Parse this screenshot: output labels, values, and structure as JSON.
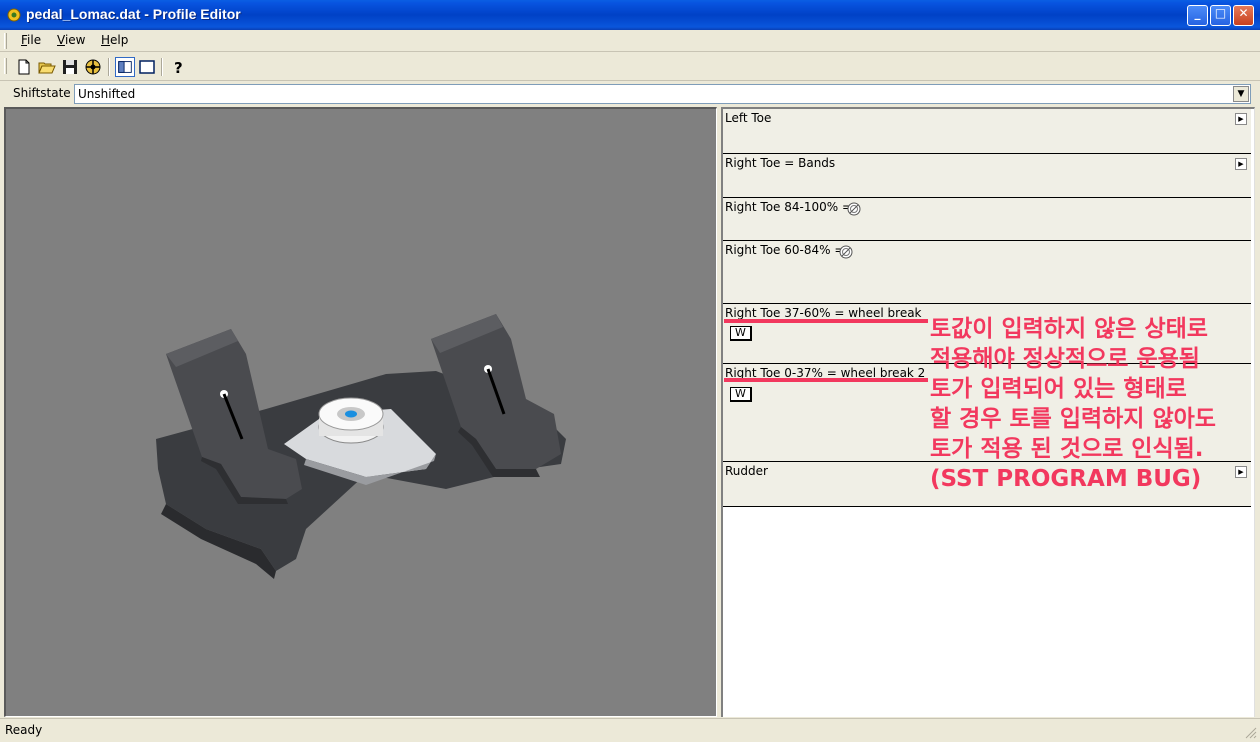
{
  "window": {
    "title": "pedal_Lomac.dat - Profile Editor",
    "minimize_glyph": "_",
    "maximize_glyph": "□",
    "close_glyph": "✕"
  },
  "menu": {
    "file": {
      "key": "F",
      "rest": "ile"
    },
    "view": {
      "key": "V",
      "rest": "iew"
    },
    "help": {
      "key": "H",
      "rest": "elp"
    }
  },
  "toolbar": {
    "icons": [
      "new-document-icon",
      "open-folder-icon",
      "save-disk-icon",
      "target-icon",
      "split-view-icon",
      "single-view-icon",
      "help-icon"
    ]
  },
  "shiftstate": {
    "label": "Shiftstate",
    "value": "Unshifted"
  },
  "panel": {
    "items": [
      {
        "label": "Left Toe",
        "arrow": "▶"
      },
      {
        "label": "Right Toe = Bands",
        "arrow": "▶"
      },
      {
        "label": "Right Toe 84-100% ="
      },
      {
        "label": "Right Toe 60-84% ="
      },
      {
        "label": "Right Toe 37-60% = wheel break",
        "button": "W"
      },
      {
        "label": "Right Toe 0-37% = wheel break 2",
        "button": "W"
      },
      {
        "label": "Rudder",
        "arrow": "▶"
      }
    ]
  },
  "annotation": {
    "lines": [
      "토값이 입력하지 않은 상태로",
      "적용해야 정상적으로 운용됨",
      "토가 입력되어 있는 형태로",
      "할 경우 토를 입력하지 않아도",
      "토가 적용 된 것으로 인식됨.",
      "(SST PROGRAM BUG)"
    ],
    "color": "#f2385e"
  },
  "status": {
    "text": "Ready"
  }
}
